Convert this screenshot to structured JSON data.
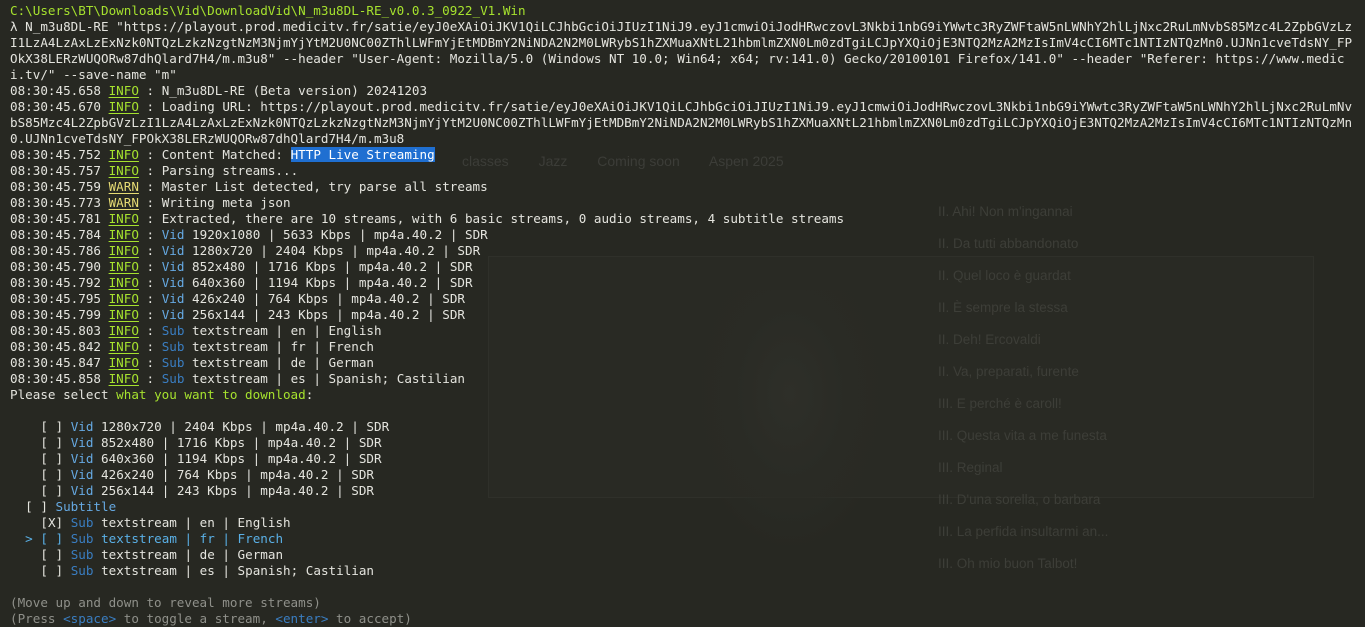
{
  "path": "C:\\Users\\BT\\Downloads\\Vid\\DownloadVid\\N_m3u8DL-RE_v0.0.3_0922_V1.Win",
  "command": "λ N_m3u8DL-RE \"https://playout.prod.medicitv.fr/satie/eyJ0eXAiOiJKV1QiLCJhbGciOiJIUzI1NiJ9.eyJ1cmwiOiJodHRwczovL3Nkbi1nbG9iYWwtc3RyZWFtaW5nLWNhY2hlLjNxc2RuLmNvbS85Mzc4L2ZpbGVzLzI1LzA4LzAxLzExNzk0NTQzLzkzNzgtNzM3NjmYjYtM2U0NC00ZThlLWFmYjEtMDBmY2NiNDA2N2M0LWRybS1hZXMuaXNtL21hbmlmZXN0Lm0zdTgiLCJpYXQiOjE3NTQ2MzA2MzIsImV4cCI6MTc1NTIzNTQzMn0.UJNn1cveTdsNY_FPOkX38LERzWUQORw87dhQlard7H4/m.m3u8\" --header \"User-Agent: Mozilla/5.0 (Windows NT 10.0; Win64; x64; rv:141.0) Gecko/20100101 Firefox/141.0\" --header \"Referer: https://www.medici.tv/\" --save-name \"m\"",
  "logs": [
    {
      "time": "08:30:45.658",
      "level": "INFO",
      "msg": "N_m3u8DL-RE (Beta version) 20241203"
    },
    {
      "time": "08:30:45.670",
      "level": "INFO",
      "msg": "Loading URL: https://playout.prod.medicitv.fr/satie/eyJ0eXAiOiJKV1QiLCJhbGciOiJIUzI1NiJ9.eyJ1cmwiOiJodHRwczovL3Nkbi1nbG9iYWwtc3RyZWFtaW5nLWNhY2hlLjNxc2RuLmNvbS85Mzc4L2ZpbGVzLzI1LzA4LzAxLzExNzk0NTQzLzkzNzgtNzM3NjmYjYtM2U0NC00ZThlLWFmYjEtMDBmY2NiNDA2N2M0LWRybS1hZXMuaXNtL21hbmlmZXN0Lm0zdTgiLCJpYXQiOjE3NTQ2MzA2MzIsImV4cCI6MTc1NTIzNTQzMn0.UJNn1cveTdsNY_FPOkX38LERzWUQORw87dhQlard7H4/m.m3u8"
    },
    {
      "time": "08:30:45.752",
      "level": "INFO",
      "msg": "Content Matched: ",
      "highlight": "HTTP Live Streaming"
    },
    {
      "time": "08:30:45.757",
      "level": "INFO",
      "msg": "Parsing streams..."
    },
    {
      "time": "08:30:45.759",
      "level": "WARN",
      "msg": "Master List detected, try parse all streams"
    },
    {
      "time": "08:30:45.773",
      "level": "WARN",
      "msg": "Writing meta json"
    },
    {
      "time": "08:30:45.781",
      "level": "INFO",
      "msg": "Extracted, there are 10 streams, with 6 basic streams, 0 audio streams, 4 subtitle streams"
    },
    {
      "time": "08:30:45.784",
      "level": "INFO",
      "tag": "Vid",
      "msg": "1920x1080 | 5633 Kbps | mp4a.40.2 | SDR"
    },
    {
      "time": "08:30:45.786",
      "level": "INFO",
      "tag": "Vid",
      "msg": "1280x720 | 2404 Kbps | mp4a.40.2 | SDR"
    },
    {
      "time": "08:30:45.790",
      "level": "INFO",
      "tag": "Vid",
      "msg": "852x480 | 1716 Kbps | mp4a.40.2 | SDR"
    },
    {
      "time": "08:30:45.792",
      "level": "INFO",
      "tag": "Vid",
      "msg": "640x360 | 1194 Kbps | mp4a.40.2 | SDR"
    },
    {
      "time": "08:30:45.795",
      "level": "INFO",
      "tag": "Vid",
      "msg": "426x240 | 764 Kbps | mp4a.40.2 | SDR"
    },
    {
      "time": "08:30:45.799",
      "level": "INFO",
      "tag": "Vid",
      "msg": "256x144 | 243 Kbps | mp4a.40.2 | SDR"
    },
    {
      "time": "08:30:45.803",
      "level": "INFO",
      "tag": "Sub",
      "msg": "textstream | en | English"
    },
    {
      "time": "08:30:45.842",
      "level": "INFO",
      "tag": "Sub",
      "msg": "textstream | fr | French"
    },
    {
      "time": "08:30:45.847",
      "level": "INFO",
      "tag": "Sub",
      "msg": "textstream | de | German"
    },
    {
      "time": "08:30:45.858",
      "level": "INFO",
      "tag": "Sub",
      "msg": "textstream | es | Spanish; Castilian"
    }
  ],
  "prompt": {
    "pre": "Please select ",
    "hl": "what you want to download",
    "post": ":"
  },
  "video_options": [
    {
      "check": "[ ]",
      "tag": "Vid",
      "text": "1280x720 | 2404 Kbps | mp4a.40.2 | SDR"
    },
    {
      "check": "[ ]",
      "tag": "Vid",
      "text": "852x480 | 1716 Kbps | mp4a.40.2 | SDR"
    },
    {
      "check": "[ ]",
      "tag": "Vid",
      "text": "640x360 | 1194 Kbps | mp4a.40.2 | SDR"
    },
    {
      "check": "[ ]",
      "tag": "Vid",
      "text": "426x240 | 764 Kbps | mp4a.40.2 | SDR"
    },
    {
      "check": "[ ]",
      "tag": "Vid",
      "text": "256x144 | 243 Kbps | mp4a.40.2 | SDR"
    }
  ],
  "subtitle_group": {
    "check": "[ ]",
    "label": "Subtitle"
  },
  "sub_options": [
    {
      "cursor": "",
      "check_open": "[",
      "check_mark": "X",
      "check_close": "]",
      "tag": "Sub",
      "text": "textstream | en | English",
      "selected": false
    },
    {
      "cursor": ">",
      "check_open": "[",
      "check_mark": " ",
      "check_close": "]",
      "tag": "Sub",
      "text": "textstream | fr | French",
      "selected": true
    },
    {
      "cursor": "",
      "check_open": "[",
      "check_mark": " ",
      "check_close": "]",
      "tag": "Sub",
      "text": "textstream | de | German",
      "selected": false
    },
    {
      "cursor": "",
      "check_open": "[",
      "check_mark": " ",
      "check_close": "]",
      "tag": "Sub",
      "text": "textstream | es | Spanish; Castilian",
      "selected": false
    }
  ],
  "hint1": "(Move up and down to reveal more streams)",
  "hint2": {
    "p1": "(Press ",
    "k1": "<space>",
    "p2": " to toggle a stream, ",
    "k2": "<enter>",
    "p3": " to accept)"
  },
  "background_ghost": {
    "nav": [
      "classes",
      "Jazz",
      "Coming soon",
      "Aspen 2025"
    ],
    "list": [
      "II. Ahi! Non m'ingannai",
      "II. Da tutti abbandonato",
      "II. Quel loco è guardat",
      "II. È sempre la stessa",
      "II. Deh! Ercovaldi",
      "II. Va, preparati, furente",
      "III. E perché è caroll!",
      "III. Questa vita a me funesta",
      "III. Reginal",
      "III. D'una sorella, o barbara",
      "III. La perfida insultarmi an...",
      "III. Oh mio buon Talbot!"
    ]
  },
  "colors": {
    "bg": "#272822",
    "info": "#a6e22e",
    "warn": "#e6db74",
    "tag": "#66a9e2",
    "selection": "#1f6fd1"
  }
}
